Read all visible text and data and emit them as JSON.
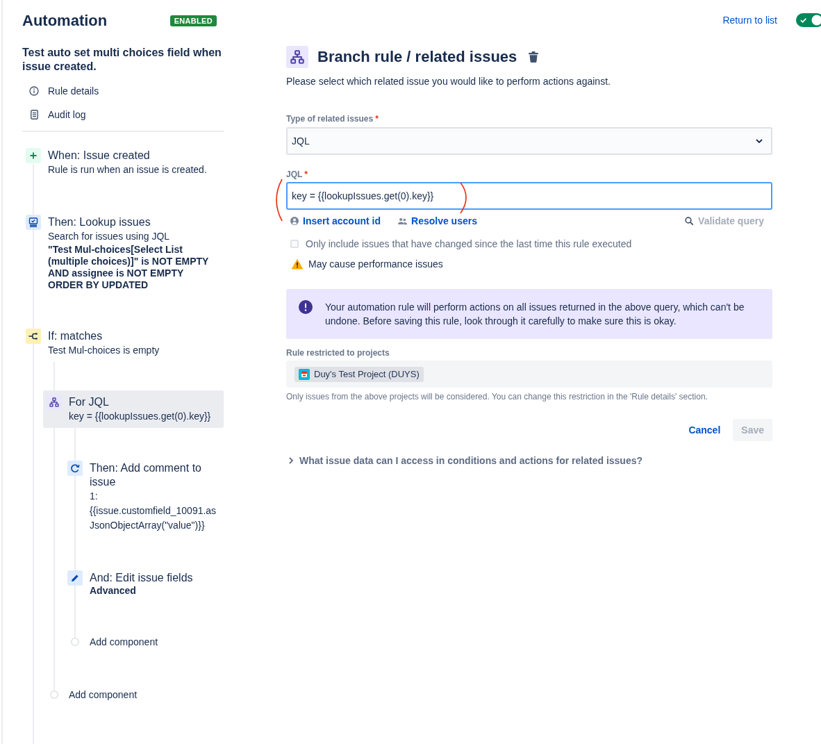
{
  "header": {
    "title": "Automation",
    "badge": "ENABLED",
    "return_link": "Return to list",
    "rule_enabled": true
  },
  "rule": {
    "name": "Test auto set multi choices field when issue created.",
    "links": [
      {
        "kind": "info",
        "label": "Rule details"
      },
      {
        "kind": "log",
        "label": "Audit log"
      }
    ]
  },
  "components": [
    {
      "kind": "trigger",
      "title": "When: Issue created",
      "description": "Rule is run when an issue is created.",
      "selected": false
    },
    {
      "kind": "lookup",
      "title": "Then: Lookup issues",
      "description": "Search for issues using JQL",
      "detail": "\"Test Mul-choices[Select List (multiple choices)]\" is NOT EMPTY AND assignee is NOT EMPTY ORDER BY UPDATED",
      "selected": false
    },
    {
      "kind": "condition",
      "title": "If: matches",
      "description": "Test Mul-choices is empty",
      "selected": false,
      "children": [
        {
          "kind": "branch",
          "title": "For JQL",
          "description": "key = {{lookupIssues.get(0).key}}",
          "selected": true,
          "children": [
            {
              "kind": "comment",
              "title": "Then: Add comment to issue",
              "description": "1: {{issue.customfield_10091.asJsonObjectArray(\"value\")}}",
              "selected": false
            },
            {
              "kind": "edit",
              "title": "And: Edit issue fields",
              "detail": "Advanced",
              "selected": false
            },
            {
              "kind": "add",
              "title": "Add component",
              "selected": false
            }
          ]
        },
        {
          "kind": "add",
          "title": "Add component",
          "selected": false
        }
      ]
    }
  ],
  "editor": {
    "title": "Branch rule / related issues",
    "description": "Please select which related issue you would like to perform actions against.",
    "type_field": {
      "label": "Type of related issues",
      "required_mark": "*",
      "value": "JQL"
    },
    "jql_field": {
      "label": "JQL",
      "required_mark": "*",
      "value": "key = {{lookupIssues.get(0).key}}",
      "focused": true
    },
    "helpers": [
      {
        "kind": "account",
        "label": "Insert account id",
        "disabled": false
      },
      {
        "kind": "users",
        "label": "Resolve users",
        "disabled": false
      },
      {
        "kind": "validate",
        "label": "Validate query",
        "disabled": true
      }
    ],
    "only_changed": {
      "label": "Only include issues that have changed since the last time this rule executed",
      "checked": false
    },
    "warning": "May cause performance issues",
    "notice": "Your automation rule will perform actions on all issues returned in the above query, which can't be undone. Before saving this rule, look through it carefully to make sure this is okay.",
    "projects": {
      "label": "Rule restricted to projects",
      "items": [
        {
          "name": "Duy's Test Project (DUYS)"
        }
      ],
      "help": "Only issues from the above projects will be considered. You can change this restriction in the 'Rule details' section."
    },
    "buttons": [
      {
        "kind": "subtle",
        "label": "Cancel",
        "disabled": false
      },
      {
        "kind": "primary",
        "label": "Save",
        "disabled": true
      }
    ],
    "faq": {
      "label": "What issue data can I access in conditions and actions for related issues?",
      "expanded": false
    }
  }
}
